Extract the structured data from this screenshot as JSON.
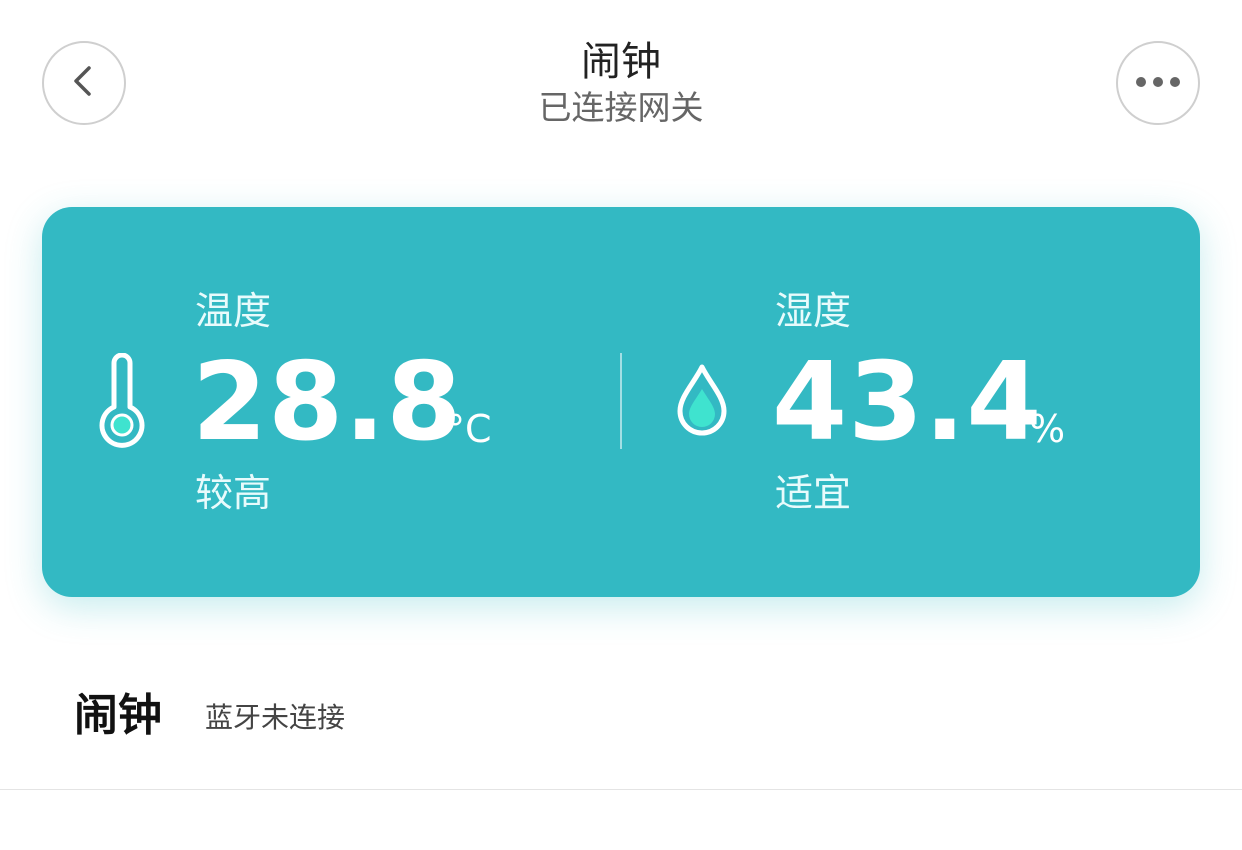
{
  "header": {
    "title": "闹钟",
    "subtitle": "已连接网关",
    "back_icon": "chevron-left-icon",
    "more_icon": "more-horizontal-icon"
  },
  "card": {
    "background_color": "#33b9c3",
    "temperature": {
      "label": "温度",
      "value": "28.8",
      "unit": "°C",
      "status": "较高",
      "icon": "thermometer-icon"
    },
    "humidity": {
      "label": "湿度",
      "value": "43.4",
      "unit": "%",
      "status": "适宜",
      "icon": "water-drop-icon"
    }
  },
  "device": {
    "name": "闹钟",
    "status": "蓝牙未连接"
  }
}
